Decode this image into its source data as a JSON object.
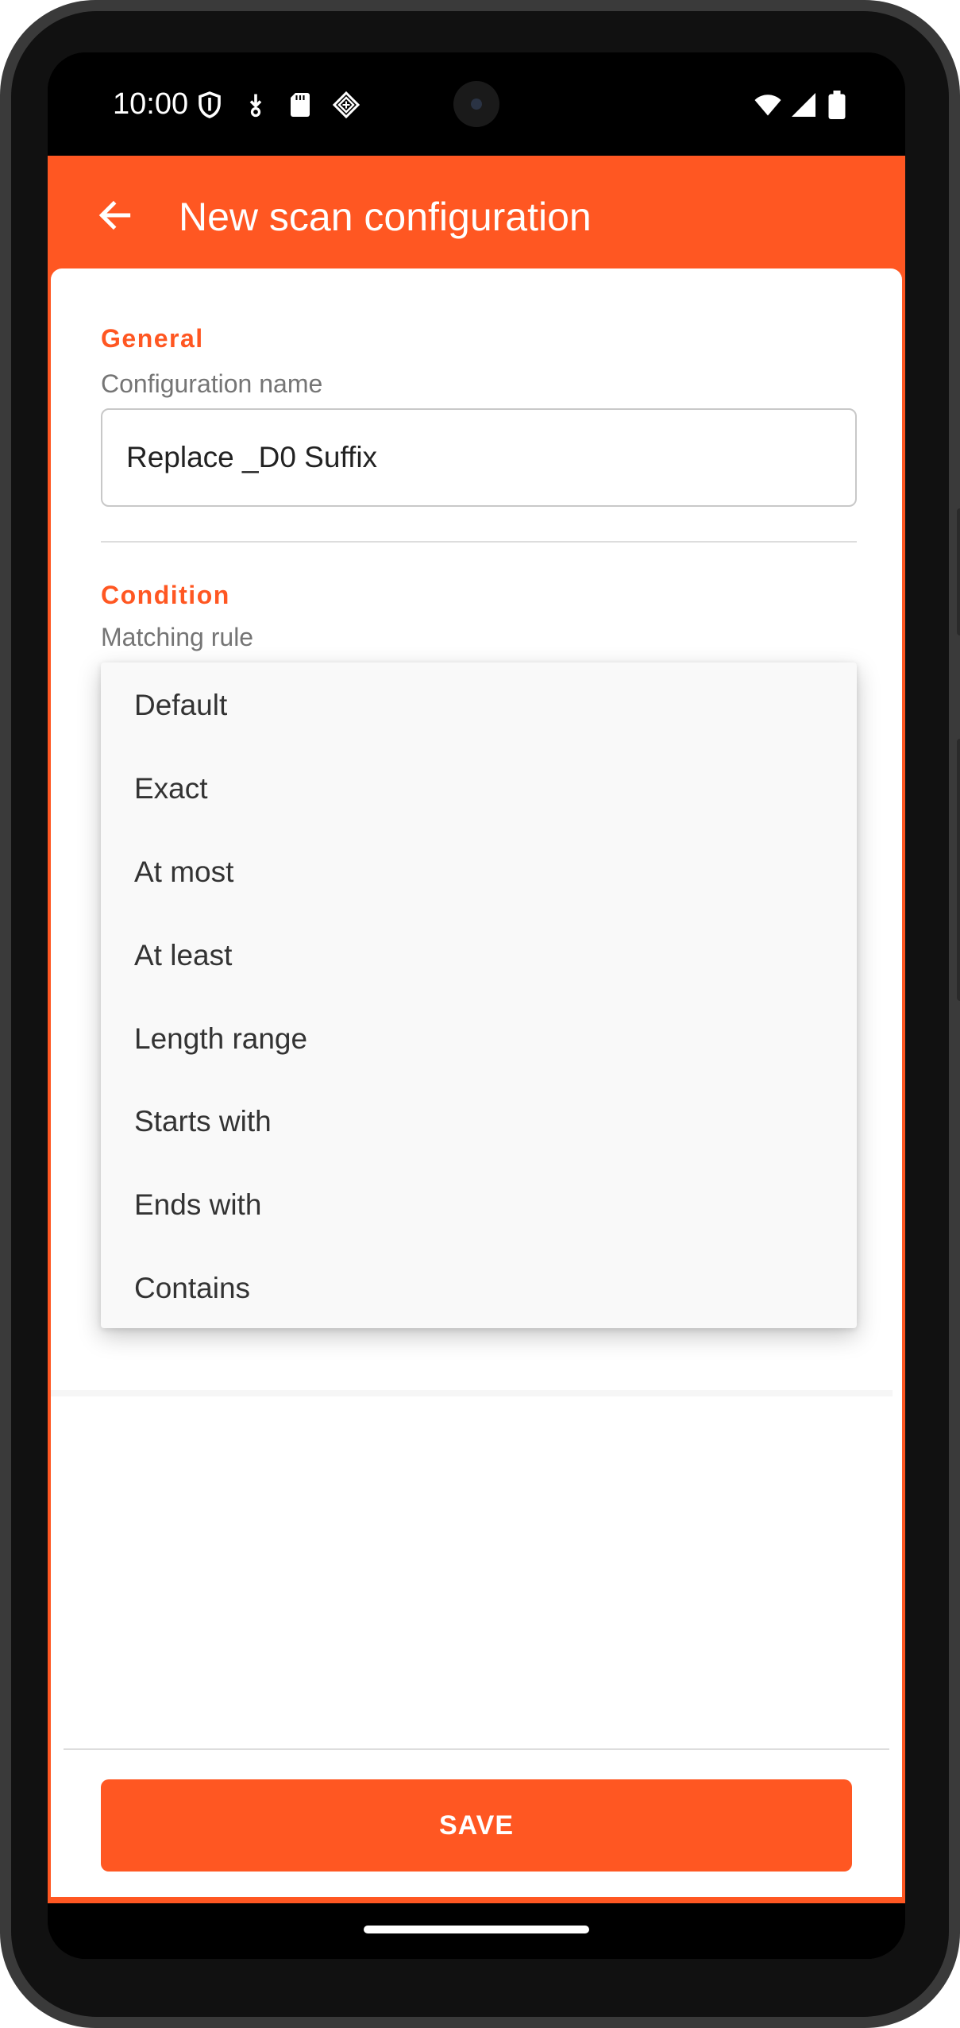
{
  "status_bar": {
    "time": "10:00",
    "left_icons": [
      "shield-icon",
      "download-icon",
      "sd-card-icon",
      "app-icon"
    ],
    "right_icons": [
      "wifi-icon",
      "signal-icon",
      "battery-icon"
    ]
  },
  "app_bar": {
    "title": "New scan configuration",
    "back_icon": "arrow-back-icon"
  },
  "general": {
    "section_title": "General",
    "config_name_label": "Configuration name",
    "config_name_value": "Replace _D0 Suffix"
  },
  "condition": {
    "section_title": "Condition",
    "matching_rule_label": "Matching rule"
  },
  "dropdown": {
    "options": [
      "Default",
      "Exact",
      "At most",
      "At least",
      "Length range",
      "Starts with",
      "Ends with",
      "Contains"
    ]
  },
  "save_button": {
    "label": "SAVE"
  },
  "colors": {
    "accent": "#ff5722",
    "label": "#757575",
    "text": "#222222"
  }
}
